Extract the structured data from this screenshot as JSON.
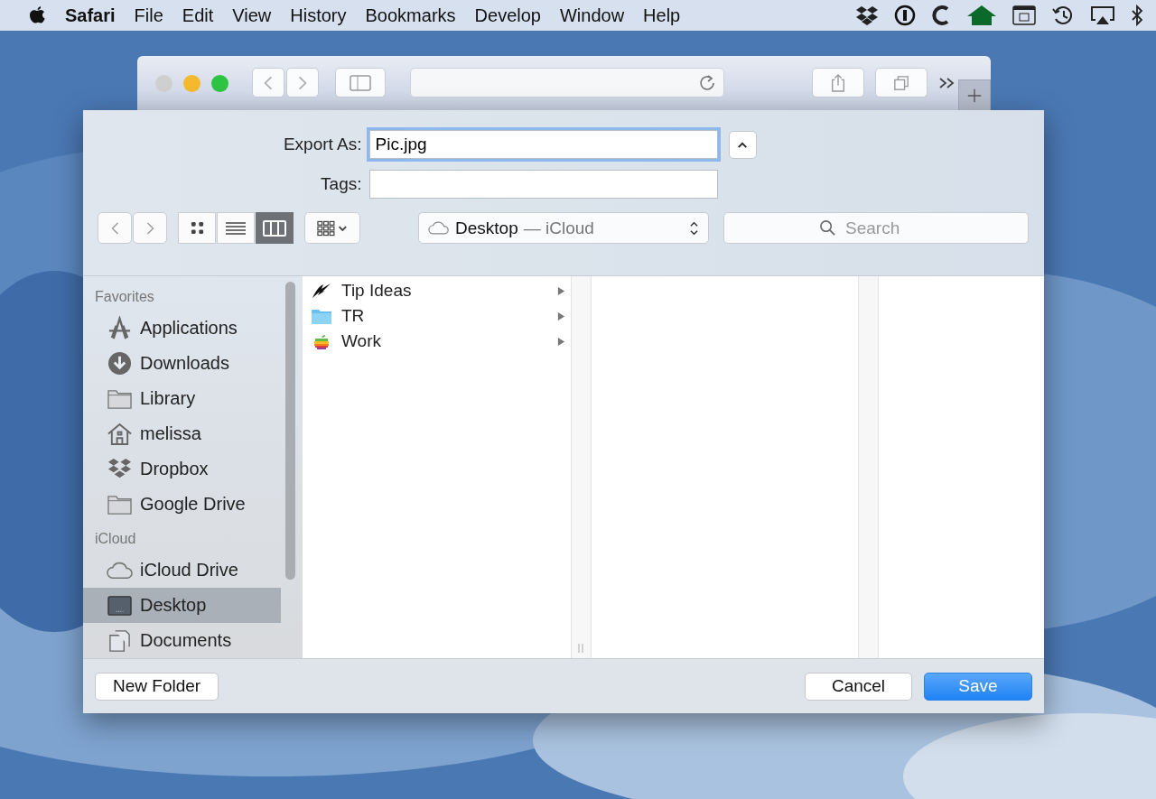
{
  "menu_bar": {
    "app": "Safari",
    "items": [
      "File",
      "Edit",
      "View",
      "History",
      "Bookmarks",
      "Develop",
      "Window",
      "Help"
    ]
  },
  "dialog": {
    "export_as": {
      "label": "Export As:",
      "value": "Pic.jpg"
    },
    "tags": {
      "label": "Tags:"
    },
    "view_modes": [
      {
        "selected": false
      },
      {
        "selected": false
      },
      {
        "selected": true
      }
    ],
    "location": {
      "name": "Desktop",
      "service": "— iCloud"
    },
    "search": {
      "placeholder": "Search"
    },
    "sidebar": [
      {
        "title": "Favorites",
        "items": [
          {
            "label": "Applications",
            "selected": false
          },
          {
            "label": "Downloads",
            "selected": false
          },
          {
            "label": "Library",
            "selected": false
          },
          {
            "label": "melissa",
            "selected": false
          },
          {
            "label": "Dropbox",
            "selected": false
          },
          {
            "label": "Google Drive",
            "selected": false
          }
        ]
      },
      {
        "title": "iCloud",
        "items": [
          {
            "label": "iCloud Drive",
            "selected": false
          },
          {
            "label": "Desktop",
            "selected": true
          },
          {
            "label": "Documents",
            "selected": false
          }
        ]
      }
    ],
    "files": [
      {
        "name": "Tip Ideas"
      },
      {
        "name": "TR"
      },
      {
        "name": "Work"
      }
    ],
    "buttons": {
      "new_folder": "New Folder",
      "cancel": "Cancel",
      "save": "Save"
    }
  }
}
